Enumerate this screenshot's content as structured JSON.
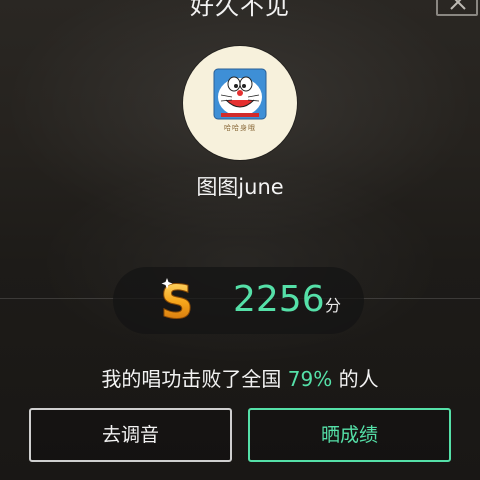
{
  "dialog": {
    "title": "好久不见"
  },
  "user": {
    "name": "图图june",
    "avatar_caption": "哈哈身哦"
  },
  "score": {
    "value": "2256",
    "unit": "分",
    "grade_icon": "grade-s-icon"
  },
  "rank": {
    "prefix": "我的唱功击败了全国 ",
    "percent": "79%",
    "suffix": " 的人"
  },
  "buttons": {
    "tune_label": "去调音",
    "share_label": "晒成绩"
  },
  "colors": {
    "accent": "#55e0a8",
    "background": "#1d1b18"
  }
}
